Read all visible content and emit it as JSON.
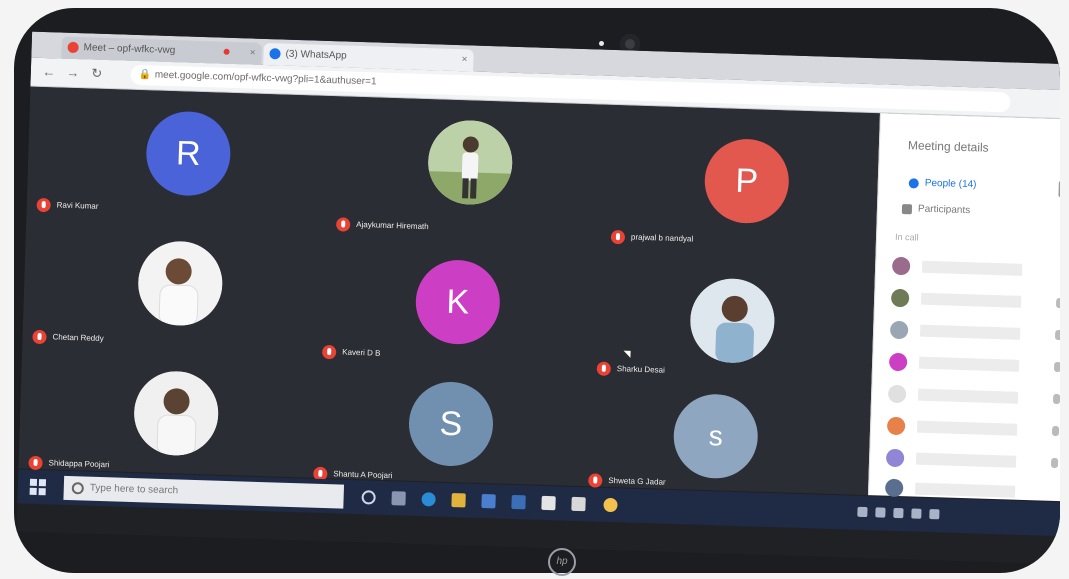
{
  "brand": "hp",
  "colors": {
    "screen_bg": "#202124",
    "avatar_blue": "#4a63d8",
    "avatar_coral": "#e2584f",
    "avatar_magenta": "#cc3fc4",
    "avatar_steel": "#7190b0",
    "avatar_pale": "#8ea6bf",
    "muted_red": "#ea4335",
    "taskbar": "#1f2a44"
  },
  "browser": {
    "tab1_title": "Meet – opf-wfkc-vwg",
    "tab2_title": "(3) WhatsApp",
    "tab_close": "×",
    "url": "meet.google.com/opf-wfkc-vwg?pli=1&authuser=1"
  },
  "participants": [
    {
      "initial": "R",
      "name": "Ravi Kumar",
      "color": "#4a63d8",
      "type": "initial"
    },
    {
      "initial": "",
      "name": "Ajaykumar Hiremath",
      "color": "",
      "type": "photo"
    },
    {
      "initial": "P",
      "name": "prajwal b nandyal",
      "color": "#e2584f",
      "type": "initial"
    },
    {
      "initial": "",
      "name": "Chetan Reddy",
      "color": "",
      "type": "photo"
    },
    {
      "initial": "K",
      "name": "Kaveri D B",
      "color": "#cc3fc4",
      "type": "initial"
    },
    {
      "initial": "",
      "name": "Sharku Desai",
      "color": "",
      "type": "photo"
    },
    {
      "initial": "",
      "name": "Shidappa Poojari",
      "color": "",
      "type": "photo"
    },
    {
      "initial": "S",
      "name": "Shantu A Poojari",
      "color": "#7190b0",
      "type": "initial"
    },
    {
      "initial": "s",
      "name": "Shweta G Jadar",
      "color": "#8ea6bf",
      "type": "initial"
    }
  ],
  "panel": {
    "title": "Meeting details",
    "people_tab": "People (14)",
    "participants_label": "Participants",
    "section": "In call"
  },
  "taskbar": {
    "search_placeholder": "Type here to search"
  },
  "icons": [
    "microphone-off-icon",
    "people-icon",
    "chat-icon",
    "windows-start-icon",
    "search-icon",
    "lock-icon",
    "reload-icon",
    "back-arrow-icon",
    "forward-arrow-icon",
    "camera-icon",
    "hp-logo"
  ]
}
